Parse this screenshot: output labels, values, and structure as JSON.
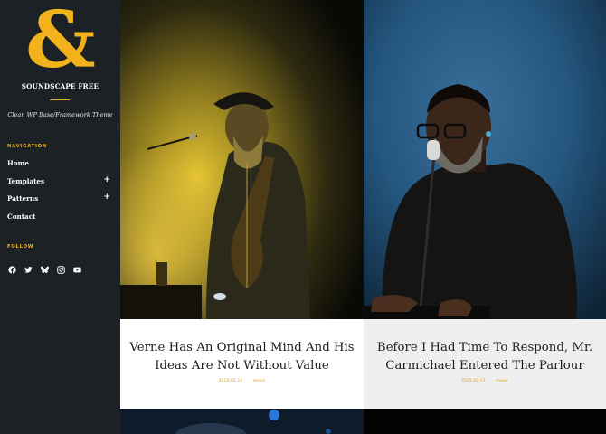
{
  "site": {
    "logo_glyph": "&",
    "title": "SOUNDSCAPE FREE",
    "tagline": "Clean WP Base/Framework Theme",
    "accent_color": "#f1b21b"
  },
  "navigation": {
    "heading": "NAVIGATION",
    "items": [
      {
        "label": "Home",
        "has_submenu": false
      },
      {
        "label": "Templates",
        "has_submenu": true,
        "toggle": "+"
      },
      {
        "label": "Patterns",
        "has_submenu": true,
        "toggle": "+"
      },
      {
        "label": "Contact",
        "has_submenu": false
      }
    ]
  },
  "follow": {
    "heading": "FOLLOW",
    "icons": [
      "facebook-icon",
      "twitter-icon",
      "bluesky-icon",
      "instagram-icon",
      "youtube-icon"
    ]
  },
  "posts": [
    {
      "title": "Verne Has An Original Mind And His Ideas Are Not Without Value",
      "date": "2025-02-11",
      "category": "music"
    },
    {
      "title": "Before I Had Time To Respond, Mr. Carmichael Entered The Parlour",
      "date": "2025-02-11",
      "category": "music"
    }
  ]
}
